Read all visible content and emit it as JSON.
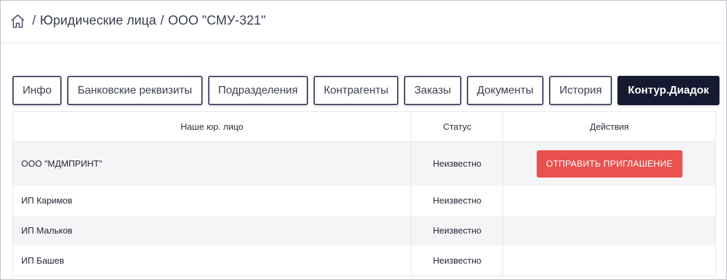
{
  "breadcrumb": {
    "home_icon": "home-icon",
    "separator": "/",
    "items": [
      "Юридические лица",
      "ООО \"СМУ-321\""
    ]
  },
  "tabs": [
    {
      "label": "Инфо",
      "active": false
    },
    {
      "label": "Банковские реквизиты",
      "active": false
    },
    {
      "label": "Подразделения",
      "active": false
    },
    {
      "label": "Контрагенты",
      "active": false
    },
    {
      "label": "Заказы",
      "active": false
    },
    {
      "label": "Документы",
      "active": false
    },
    {
      "label": "История",
      "active": false
    },
    {
      "label": "Контур.Диадок",
      "active": true
    }
  ],
  "table": {
    "headers": {
      "name": "Наше юр. лицо",
      "status": "Статус",
      "actions": "Действия"
    },
    "rows": [
      {
        "name": "ООО \"МДМПРИНТ\"",
        "status": "Неизвестно",
        "action": "ОТПРАВИТЬ ПРИГЛАШЕНИЕ"
      },
      {
        "name": "ИП Каримов",
        "status": "Неизвестно",
        "action": ""
      },
      {
        "name": "ИП Мальков",
        "status": "Неизвестно",
        "action": ""
      },
      {
        "name": "ИП Башев",
        "status": "Неизвестно",
        "action": ""
      }
    ]
  },
  "colors": {
    "active_tab_bg": "#161a30",
    "invite_button_bg": "#e8524f",
    "stripe_bg": "#f5f5f7"
  }
}
